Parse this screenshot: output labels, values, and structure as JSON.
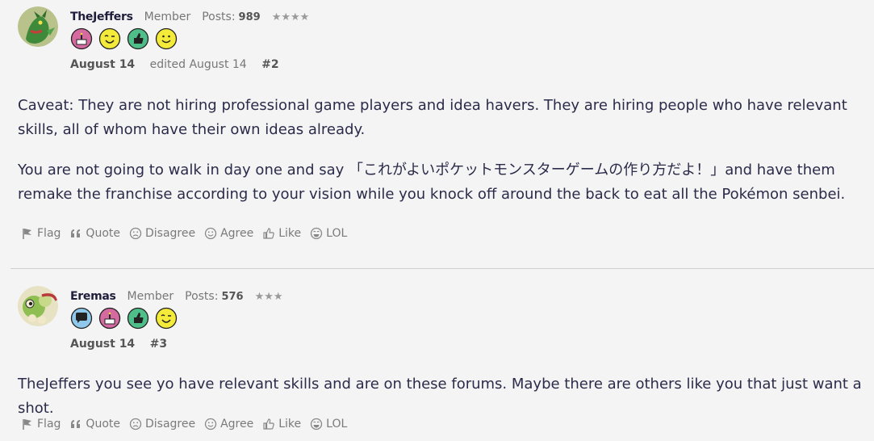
{
  "colors": {
    "background": "#f4f4f4",
    "text": "#2b2b4a",
    "muted": "#777777",
    "divider": "#cfcfcf"
  },
  "posts": [
    {
      "username": "TheJeffers",
      "role": "Member",
      "posts_label": "Posts:",
      "posts_count": "989",
      "stars": "★★★★",
      "badges": [
        "cake-badge-icon",
        "wink-badge-icon",
        "thumbs-up-badge-icon",
        "smile-badge-icon"
      ],
      "date": "August 14",
      "edited": "edited August 14",
      "permalink": "#2",
      "paragraphs": [
        "Caveat: They are not hiring professional game players and idea havers. They are hiring people who have relevant skills, all of whom have their own ideas already.",
        "You are not going to walk in day one and say 「これがよいポケットモンスターゲームの作り方だよ！」and have them remake the franchise according to your vision while you knock off around the back to eat all the Pokémon senbei."
      ]
    },
    {
      "username": "Eremas",
      "role": "Member",
      "posts_label": "Posts:",
      "posts_count": "576",
      "stars": "★★★",
      "badges": [
        "speech-badge-icon",
        "cake-badge-icon",
        "thumbs-up-badge-icon",
        "wink-badge-icon"
      ],
      "date": "August 14",
      "permalink": "#3",
      "paragraphs": [
        "TheJeffers you see yo have relevant skills and are on these forums. Maybe there are others like you that just want a shot."
      ]
    }
  ],
  "reactions": {
    "flag": "Flag",
    "quote": "Quote",
    "disagree": "Disagree",
    "agree": "Agree",
    "like": "Like",
    "lol": "LOL"
  }
}
